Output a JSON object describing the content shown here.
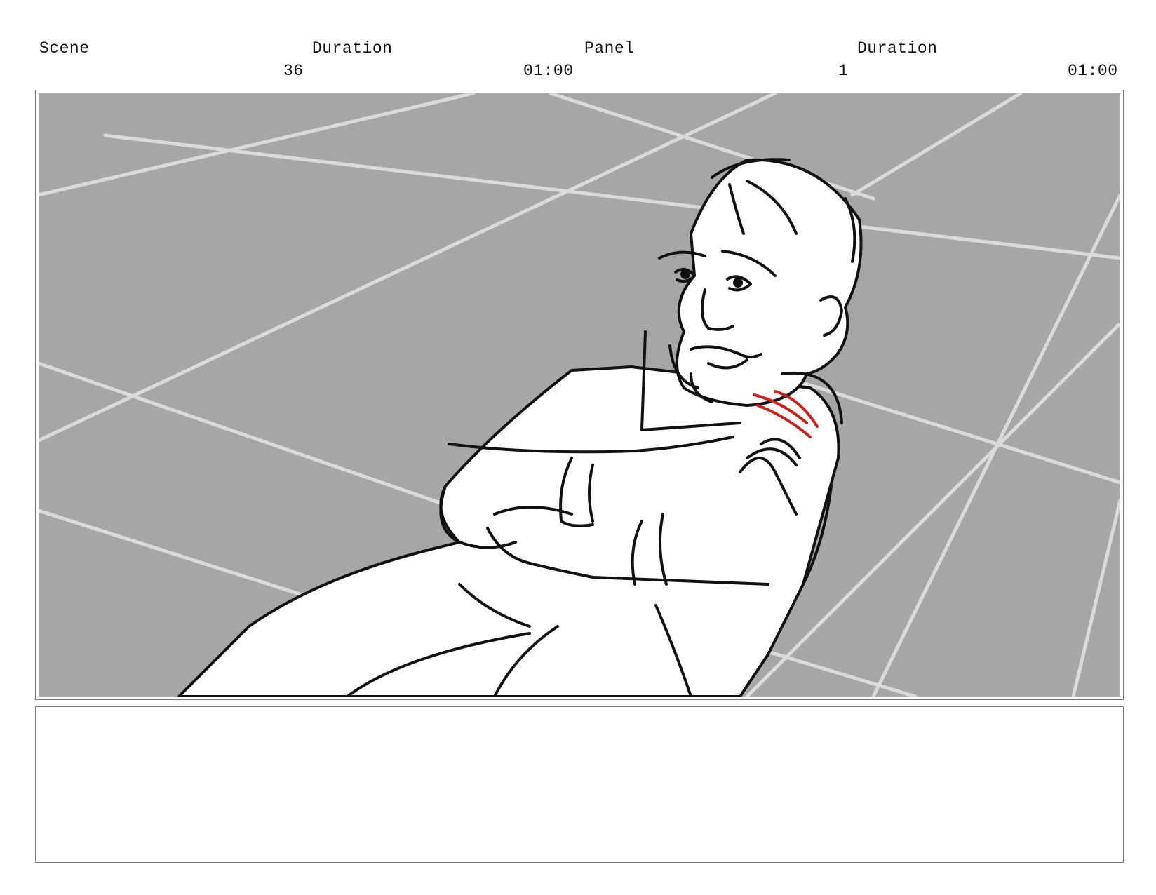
{
  "header": {
    "scene_label": "Scene",
    "scene_duration_label": "Duration",
    "panel_label": "Panel",
    "panel_duration_label": "Duration",
    "scene_number": "36",
    "scene_duration": "01:00",
    "panel_number": "1",
    "panel_duration": "01:00"
  },
  "colors": {
    "floor": "#a6a6a6",
    "floor_lines": "#dadada",
    "ink": "#111111",
    "wound": "#d0201a",
    "border": "#777777"
  },
  "notes": {
    "text": ""
  }
}
